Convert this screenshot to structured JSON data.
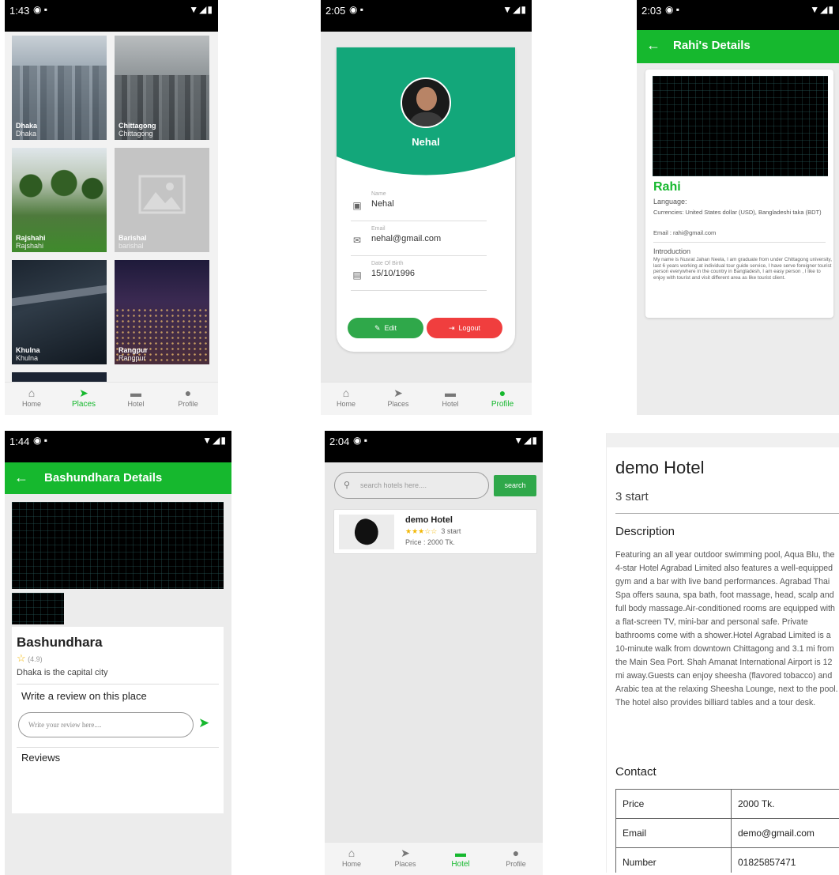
{
  "colors": {
    "accent": "#16b82e",
    "teal": "#13a77a",
    "red": "#f03e3e",
    "star": "#f2b705"
  },
  "nav": {
    "home": "Home",
    "places": "Places",
    "hotel": "Hotel",
    "profile": "Profile"
  },
  "screen1": {
    "time": "1:43",
    "cities": [
      {
        "name": "Dhaka",
        "sub": "Dhaka"
      },
      {
        "name": "Chittagong",
        "sub": "Chittagong"
      },
      {
        "name": "Rajshahi",
        "sub": "Rajshahi"
      },
      {
        "name": "Barishal",
        "sub": "barishal"
      },
      {
        "name": "Khulna",
        "sub": "Khulna"
      },
      {
        "name": "Rangpur",
        "sub": "Rangpur"
      }
    ]
  },
  "screen2": {
    "time": "2:05",
    "profile_name": "Nehal",
    "fields": [
      {
        "icon": "person-card-icon",
        "label": "Name",
        "value": "Nehal"
      },
      {
        "icon": "mail-icon",
        "label": "Email",
        "value": "nehal@gmail.com"
      },
      {
        "icon": "calendar-icon",
        "label": "Date Of Birth",
        "value": "15/10/1996"
      }
    ],
    "edit_label": "Edit",
    "logout_label": "Logout"
  },
  "screen3": {
    "time": "2:03",
    "title": "Rahi's Details",
    "name": "Rahi",
    "language": "Language:",
    "currencies": "Currencies: United States dollar (USD), Bangladeshi taka (BDT)",
    "email": "Email : rahi@gmail.com",
    "intro_heading": "Introduction",
    "intro_text": "My name is Nusrat Jahan Neela, I am graduate from under Chittagong university, last 6 years working at individual tour guide service, I have serve foreigner tourist person everywhere in the country in Bangladesh, I am easy person , I like to enjoy with tourist and visit different area as like tourist client."
  },
  "screen4": {
    "time": "1:44",
    "title": "Bashundhara Details",
    "place_name": "Bashundhara",
    "rating": "(4.9)",
    "desc": "Dhaka is the capital city",
    "review_heading": "Write a review on this place",
    "review_placeholder": "Write your review here....",
    "reviews_heading": "Reviews"
  },
  "screen5": {
    "time": "2:04",
    "search_placeholder": "search hotels here....",
    "search_button": "search",
    "hotel": {
      "name": "demo Hotel",
      "stars": "★★★☆☆",
      "rating_text": "3 start",
      "price": "Price : 2000 Tk."
    }
  },
  "screen6": {
    "name": "demo Hotel",
    "rating_text": "3 start",
    "desc_heading": "Description",
    "desc": "Featuring an all year outdoor swimming pool, Aqua Blu, the 4-star Hotel Agrabad Limited also features a well-equipped gym and a bar with live band performances. Agrabad Thai Spa offers sauna, spa bath, foot massage, head, scalp and full body massage.Air-conditioned rooms are equipped with a flat-screen TV, mini-bar and personal safe. Private bathrooms come with a shower.Hotel Agrabad Limited is a 10-minute walk from downtown Chittagong and 3.1 mi from the Main Sea Port. Shah Amanat International Airport is 12 mi away.Guests can enjoy sheesha (flavored tobacco) and Arabic tea at the relaxing Sheesha Lounge, next to the pool. The hotel also provides billiard tables and a tour desk.",
    "contact_heading": "Contact",
    "contact": [
      {
        "label": "Price",
        "value": "2000 Tk."
      },
      {
        "label": "Email",
        "value": "demo@gmail.com"
      },
      {
        "label": "Number",
        "value": "01825857471"
      }
    ]
  }
}
